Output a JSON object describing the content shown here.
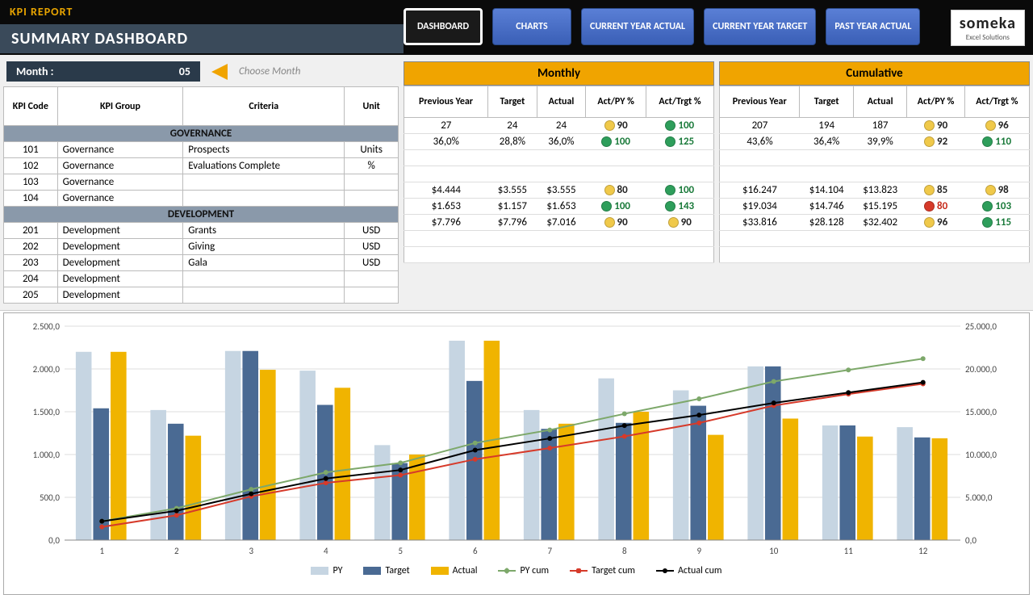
{
  "header": {
    "title": "KPI REPORT",
    "subtitle": "SUMMARY DASHBOARD",
    "nav": [
      "DASHBOARD",
      "CHARTS",
      "CURRENT YEAR ACTUAL",
      "CURRENT YEAR TARGET",
      "PAST YEAR ACTUAL"
    ],
    "logo_main": "someka",
    "logo_sub": "Excel Solutions"
  },
  "month": {
    "label": "Month :",
    "value": "05",
    "hint": "Choose Month"
  },
  "kpi_headers": {
    "code": "KPI Code",
    "group": "KPI Group",
    "criteria": "Criteria",
    "unit": "Unit"
  },
  "sections": [
    {
      "name": "GOVERNANCE",
      "rows": [
        {
          "code": "101",
          "group": "Governance",
          "criteria": "Prospects",
          "unit": "Units"
        },
        {
          "code": "102",
          "group": "Governance",
          "criteria": "Evaluations Complete",
          "unit": "%"
        },
        {
          "code": "103",
          "group": "Governance",
          "criteria": "",
          "unit": ""
        },
        {
          "code": "104",
          "group": "Governance",
          "criteria": "",
          "unit": ""
        }
      ]
    },
    {
      "name": "DEVELOPMENT",
      "rows": [
        {
          "code": "201",
          "group": "Development",
          "criteria": "Grants",
          "unit": "USD"
        },
        {
          "code": "202",
          "group": "Development",
          "criteria": "Giving",
          "unit": "USD"
        },
        {
          "code": "203",
          "group": "Development",
          "criteria": "Gala",
          "unit": "USD"
        },
        {
          "code": "204",
          "group": "Development",
          "criteria": "",
          "unit": ""
        },
        {
          "code": "205",
          "group": "Development",
          "criteria": "",
          "unit": ""
        }
      ]
    }
  ],
  "metric_headers": {
    "py": "Previous Year",
    "target": "Target",
    "actual": "Actual",
    "actpy": "Act/PY %",
    "acttrg": "Act/Trgt %"
  },
  "metric_titles": {
    "monthly": "Monthly",
    "cumulative": "Cumulative"
  },
  "monthly": [
    {
      "py": "27",
      "target": "24",
      "actual": "24",
      "actpy": "90",
      "actpy_c": "yellow",
      "acttrg": "100",
      "acttrg_c": "green"
    },
    {
      "py": "36,0%",
      "target": "28,8%",
      "actual": "36,0%",
      "actpy": "100",
      "actpy_c": "green",
      "acttrg": "125",
      "acttrg_c": "green"
    },
    {
      "blank": true
    },
    {
      "blank": true
    },
    {
      "py": "$4.444",
      "target": "$3.555",
      "actual": "$3.555",
      "actpy": "80",
      "actpy_c": "yellow",
      "acttrg": "100",
      "acttrg_c": "green"
    },
    {
      "py": "$1.653",
      "target": "$1.157",
      "actual": "$1.653",
      "actpy": "100",
      "actpy_c": "green",
      "acttrg": "143",
      "acttrg_c": "green"
    },
    {
      "py": "$7.796",
      "target": "$7.796",
      "actual": "$7.016",
      "actpy": "90",
      "actpy_c": "yellow",
      "acttrg": "90",
      "acttrg_c": "yellow"
    },
    {
      "blank": true
    },
    {
      "blank": true
    }
  ],
  "cumulative": [
    {
      "py": "207",
      "target": "194",
      "actual": "187",
      "actpy": "90",
      "actpy_c": "yellow",
      "acttrg": "96",
      "acttrg_c": "yellow"
    },
    {
      "py": "43,6%",
      "target": "36,4%",
      "actual": "39,9%",
      "actpy": "92",
      "actpy_c": "yellow",
      "acttrg": "110",
      "acttrg_c": "green"
    },
    {
      "blank": true
    },
    {
      "blank": true
    },
    {
      "py": "$16.247",
      "target": "$14.104",
      "actual": "$13.823",
      "actpy": "85",
      "actpy_c": "yellow",
      "acttrg": "98",
      "acttrg_c": "yellow"
    },
    {
      "py": "$19.034",
      "target": "$14.746",
      "actual": "$15.195",
      "actpy": "80",
      "actpy_c": "red",
      "acttrg": "103",
      "acttrg_c": "green"
    },
    {
      "py": "$33.816",
      "target": "$28.128",
      "actual": "$32.402",
      "actpy": "96",
      "actpy_c": "yellow",
      "acttrg": "115",
      "acttrg_c": "green"
    },
    {
      "blank": true
    },
    {
      "blank": true
    }
  ],
  "legend": {
    "py": "PY",
    "target": "Target",
    "actual": "Actual",
    "pycum": "PY cum",
    "targetcum": "Target cum",
    "actualcum": "Actual cum"
  },
  "chart_data": {
    "type": "bar",
    "overlay": "line",
    "categories": [
      "1",
      "2",
      "3",
      "4",
      "5",
      "6",
      "7",
      "8",
      "9",
      "10",
      "11",
      "12"
    ],
    "ylabel_left": "",
    "ylim_left": [
      0,
      2500
    ],
    "yticks_left": [
      "0,0",
      "500,0",
      "1.000,0",
      "1.500,0",
      "2.000,0",
      "2.500,0"
    ],
    "ylabel_right": "",
    "ylim_right": [
      0,
      25000
    ],
    "yticks_right": [
      "0,0",
      "5.000,0",
      "10.000,0",
      "15.000,0",
      "20.000,0",
      "25.000,0"
    ],
    "series": [
      {
        "name": "PY",
        "type": "bar",
        "color": "#c6d5e2",
        "values": [
          2200,
          1520,
          2210,
          1980,
          1110,
          2330,
          1520,
          1890,
          1750,
          2030,
          1340,
          1320
        ]
      },
      {
        "name": "Target",
        "type": "bar",
        "color": "#4a6a93",
        "values": [
          1540,
          1360,
          2210,
          1580,
          900,
          1860,
          1300,
          1370,
          1570,
          2030,
          1340,
          1200
        ]
      },
      {
        "name": "Actual",
        "type": "bar",
        "color": "#f0b400",
        "values": [
          2200,
          1220,
          1990,
          1780,
          1000,
          2330,
          1360,
          1500,
          1230,
          1420,
          1210,
          1190
        ]
      },
      {
        "name": "PY cum",
        "type": "line",
        "color": "#7da86a",
        "axis": "right",
        "values": [
          2200,
          3720,
          5930,
          7910,
          9020,
          11350,
          12870,
          14760,
          16510,
          18540,
          19880,
          21200
        ]
      },
      {
        "name": "Target cum",
        "type": "line",
        "color": "#d63a2a",
        "axis": "right",
        "values": [
          1540,
          2900,
          5110,
          6690,
          7590,
          9450,
          10750,
          12120,
          13690,
          15720,
          17060,
          18260
        ]
      },
      {
        "name": "Actual cum",
        "type": "line",
        "color": "#000000",
        "axis": "right",
        "values": [
          2200,
          3420,
          5410,
          7190,
          8190,
          10520,
          11880,
          13380,
          14610,
          16030,
          17240,
          18430
        ]
      }
    ]
  }
}
